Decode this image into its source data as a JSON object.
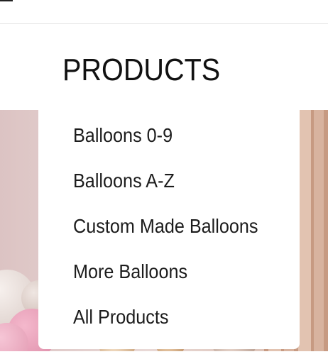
{
  "nav": {
    "title": "PRODUCTS",
    "dropdown": {
      "items": [
        {
          "label": "Balloons 0-9"
        },
        {
          "label": "Balloons A-Z"
        },
        {
          "label": "Custom Made Balloons"
        },
        {
          "label": "More Balloons"
        },
        {
          "label": "All Products"
        }
      ]
    }
  },
  "colors": {
    "text": "#111111",
    "dropdown_background": "#ffffff",
    "hero_tone": "#dcc3c3"
  },
  "icons": {
    "menu": "hamburger-menu-icon"
  }
}
